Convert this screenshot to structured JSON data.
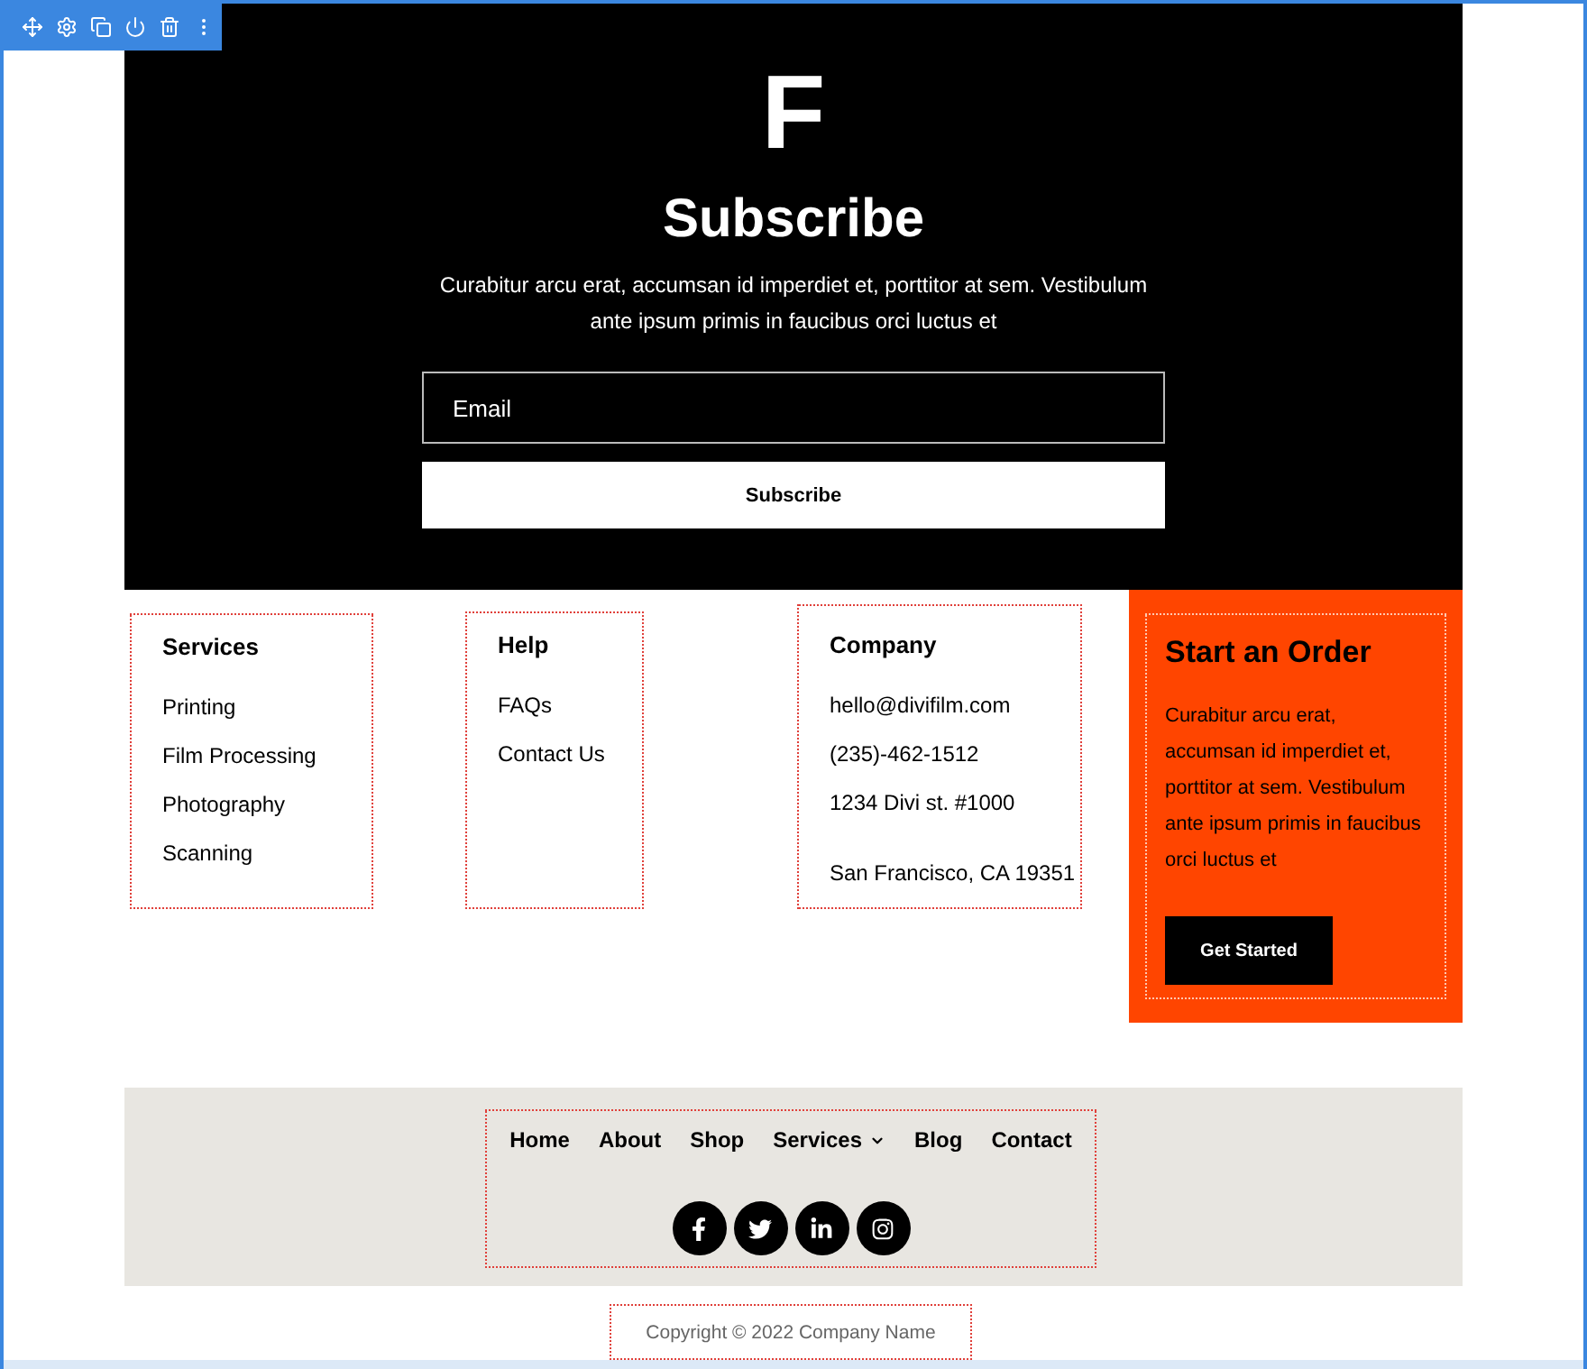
{
  "hero": {
    "logo": "F",
    "title": "Subscribe",
    "text": "Curabitur arcu erat, accumsan id imperdiet et, porttitor at sem. Vestibulum ante ipsum primis in faucibus orci luctus et",
    "email": {
      "placeholder": "Email"
    },
    "button": "Subscribe"
  },
  "services": {
    "heading": "Services",
    "items": [
      "Printing",
      "Film Processing",
      "Photography",
      "Scanning"
    ]
  },
  "help": {
    "heading": "Help",
    "items": [
      "FAQs",
      "Contact Us"
    ]
  },
  "company": {
    "heading": "Company",
    "email": "hello@divifilm.com",
    "phone": "(235)-462-1512",
    "address": [
      "1234 Divi st. #1000",
      "San Francisco, CA 19351"
    ]
  },
  "order": {
    "title": "Start an Order",
    "text": "Curabitur arcu erat, accumsan id imperdiet et, porttitor at sem. Vestibulum ante ipsum primis in faucibus orci luctus et",
    "button": "Get Started"
  },
  "nav": [
    {
      "label": "Home",
      "dropdown": false
    },
    {
      "label": "About",
      "dropdown": false
    },
    {
      "label": "Shop",
      "dropdown": false
    },
    {
      "label": "Services",
      "dropdown": true
    },
    {
      "label": "Blog",
      "dropdown": false
    },
    {
      "label": "Contact",
      "dropdown": false
    }
  ],
  "social": [
    {
      "kind": "facebook"
    },
    {
      "kind": "twitter"
    },
    {
      "kind": "linkedin"
    },
    {
      "kind": "instagram"
    }
  ],
  "copyright": "Copyright © 2022 Company Name"
}
